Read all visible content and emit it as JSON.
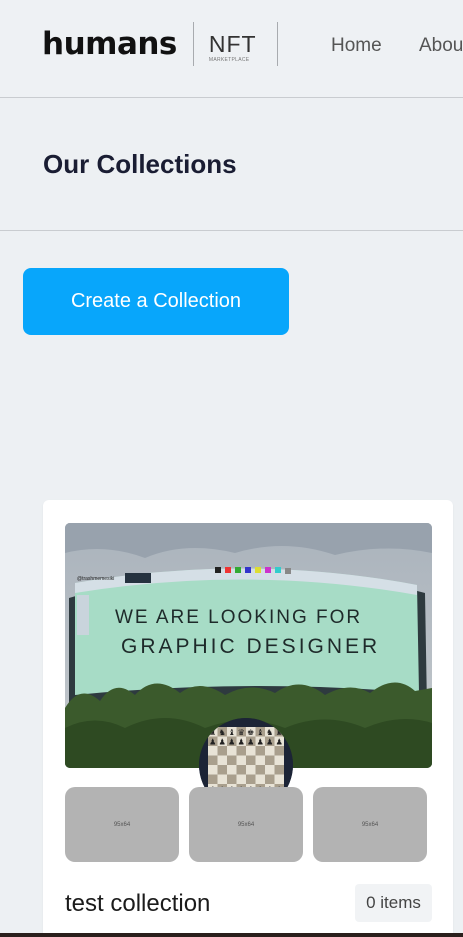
{
  "header": {
    "logo_text": "humans",
    "logo_nft": "NFT",
    "logo_marketplace": "MARKETPLACE",
    "nav": [
      {
        "label": "Home"
      },
      {
        "label": "About"
      }
    ]
  },
  "main": {
    "title": "Our Collections",
    "create_button_label": "Create a Collection"
  },
  "collection": {
    "banner_text_line1": "WE ARE LOOKING FOR",
    "banner_text_line2": "GRAPHIC DESIGNER",
    "banner_watermark": "@trashmemesiki",
    "thumbnails": [
      {
        "label": "95x64"
      },
      {
        "label": "95x64"
      },
      {
        "label": "95x64"
      }
    ],
    "name": "test collection",
    "items_count": "0 items"
  }
}
